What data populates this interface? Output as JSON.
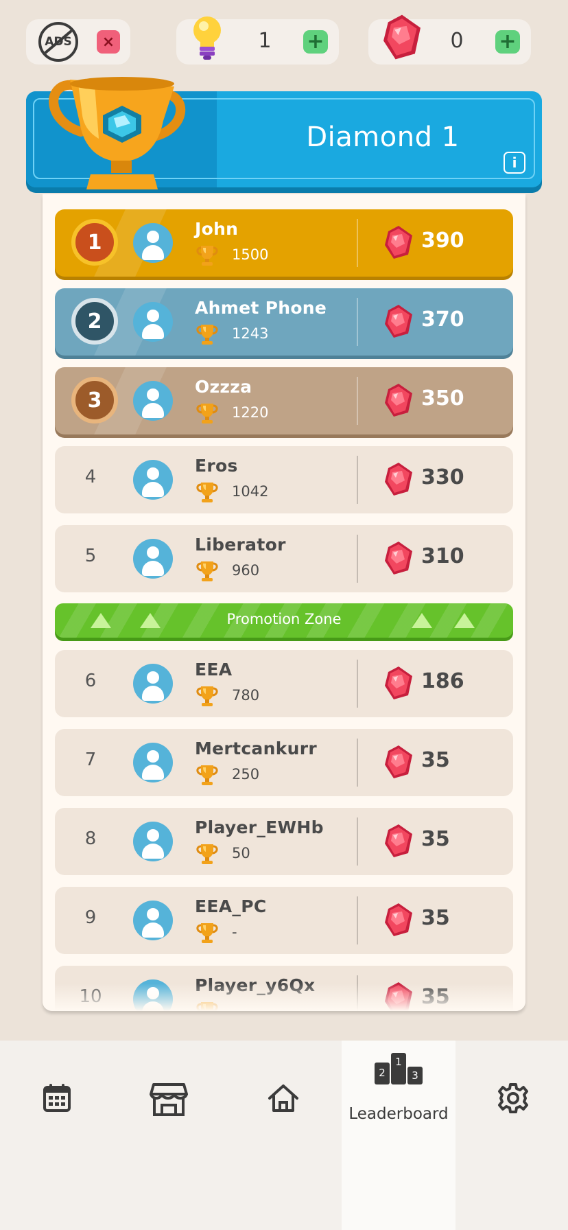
{
  "topbar": {
    "ads_label": "ADS",
    "ads_close": "×",
    "hints_count": "1",
    "gems_count": "0",
    "plus_label": "+"
  },
  "league": {
    "title": "Diamond 1",
    "info_label": "i"
  },
  "promotion_zone": "Promotion Zone",
  "players": [
    {
      "rank": "1",
      "name": "John",
      "trophies": "1500",
      "gems": "390"
    },
    {
      "rank": "2",
      "name": "Ahmet Phone",
      "trophies": "1243",
      "gems": "370"
    },
    {
      "rank": "3",
      "name": "Ozzza",
      "trophies": "1220",
      "gems": "350"
    },
    {
      "rank": "4",
      "name": "Eros",
      "trophies": "1042",
      "gems": "330"
    },
    {
      "rank": "5",
      "name": "Liberator",
      "trophies": "960",
      "gems": "310"
    },
    {
      "rank": "6",
      "name": "EEA",
      "trophies": "780",
      "gems": "186"
    },
    {
      "rank": "7",
      "name": "Mertcankurr",
      "trophies": "250",
      "gems": "35"
    },
    {
      "rank": "8",
      "name": "Player_EWHb",
      "trophies": "50",
      "gems": "35"
    },
    {
      "rank": "9",
      "name": "EEA_PC",
      "trophies": "-",
      "gems": "35"
    },
    {
      "rank": "10",
      "name": "Player_y6Qx",
      "trophies": "",
      "gems": "35"
    }
  ],
  "nav": {
    "leaderboard_label": "Leaderboard",
    "podium_1": "1",
    "podium_2": "2",
    "podium_3": "3"
  },
  "colors": {
    "gold": "#e4a200",
    "silver": "#6fa6be",
    "bronze": "#bfa387",
    "promo": "#66c22b",
    "league": "#1aa9e0",
    "gem": "#e8354f"
  },
  "icons": [
    "no-ads-icon",
    "close-icon",
    "lightbulb-icon",
    "plus-icon",
    "gem-icon",
    "trophy-icon",
    "info-icon",
    "avatar-icon",
    "calendar-icon",
    "shop-icon",
    "home-icon",
    "podium-icon",
    "gear-icon"
  ]
}
